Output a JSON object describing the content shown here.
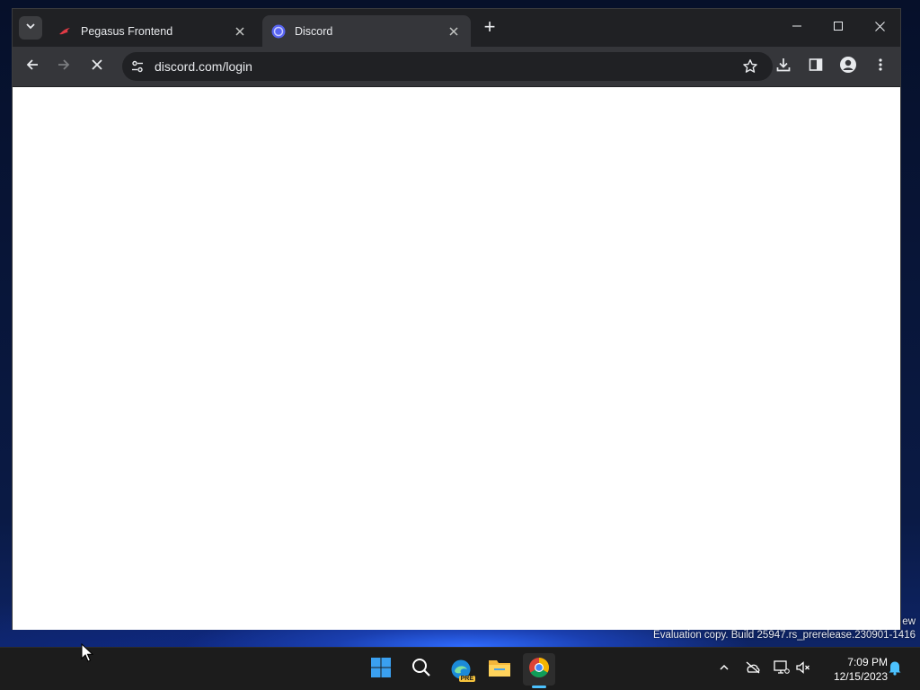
{
  "browser": {
    "tabs": [
      {
        "title": "Pegasus Frontend",
        "favicon": "pegasus-icon",
        "active": false
      },
      {
        "title": "Discord",
        "favicon": "discord-icon",
        "active": true
      }
    ],
    "new_tab": "+",
    "address": "discord.com/login",
    "loading": true
  },
  "desktop": {
    "watermark_partial_1": "ew",
    "watermark_build": "Evaluation copy. Build 25947.rs_prerelease.230901-1416"
  },
  "taskbar": {
    "apps": [
      "start-icon",
      "search-icon",
      "edge-pre-icon",
      "file-explorer-icon",
      "chrome-icon"
    ],
    "edge_badge": "PRE",
    "clock": {
      "time": "7:09 PM",
      "date": "12/15/2023"
    }
  },
  "colors": {
    "accent": "#4cc2ff",
    "browser_frame": "#202124",
    "toolbar": "#35363a",
    "taskbar": "#1c1c1c"
  }
}
